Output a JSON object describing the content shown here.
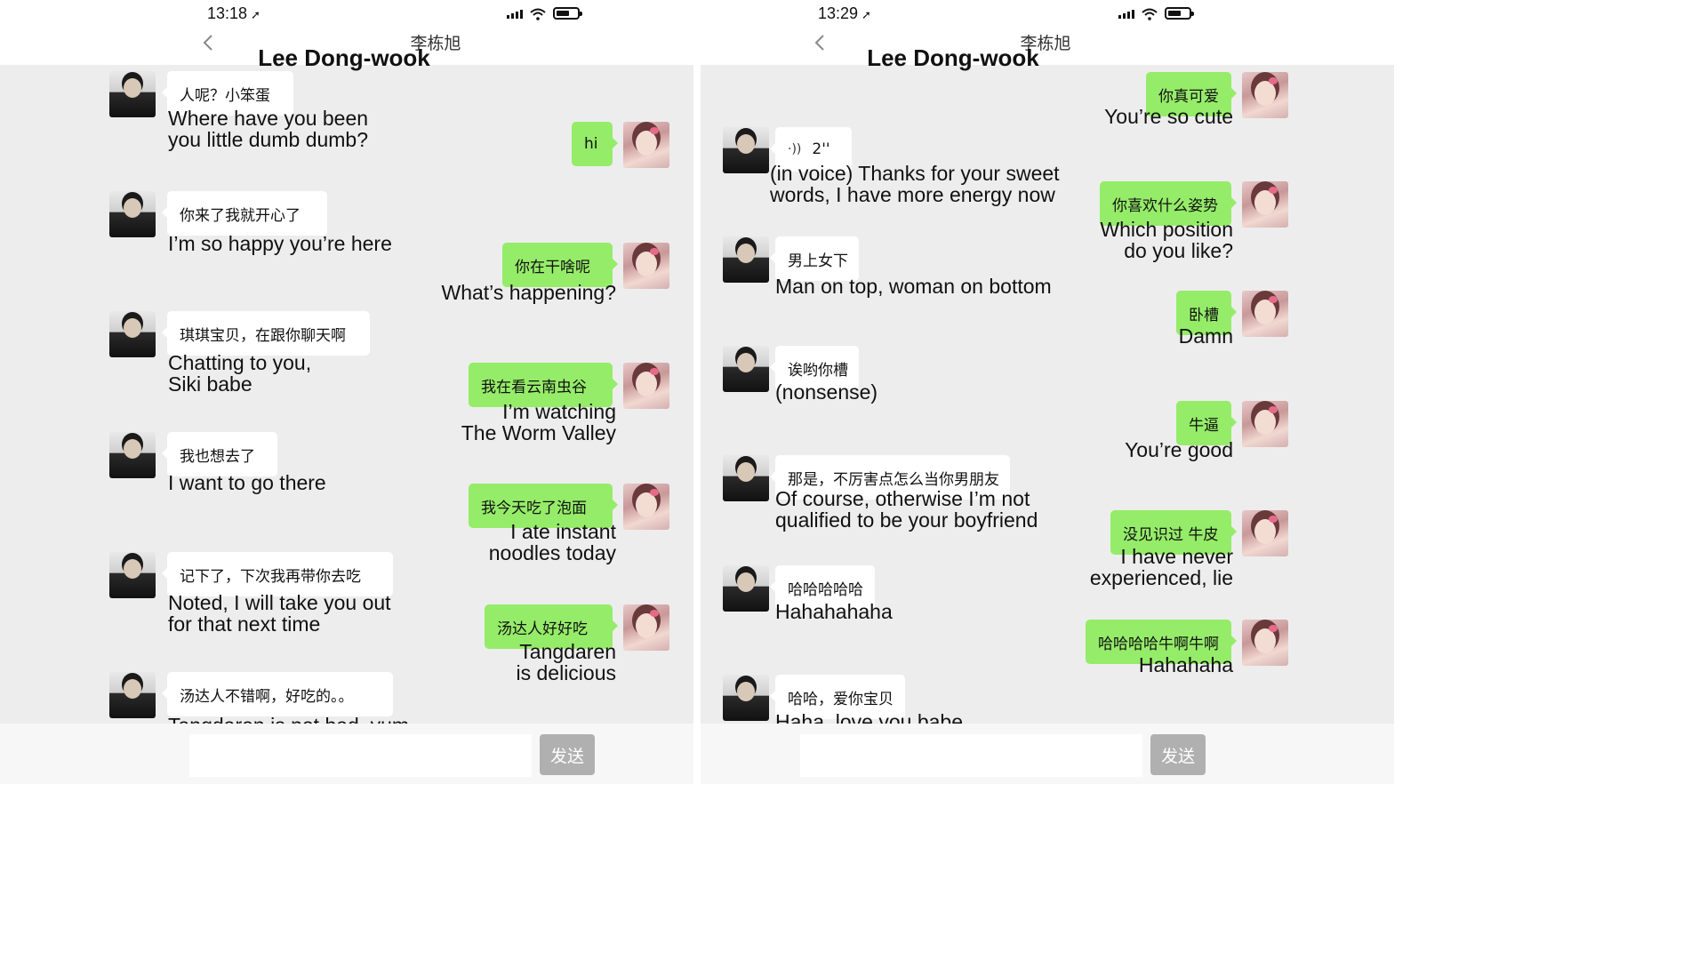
{
  "panels": [
    {
      "status": {
        "time": "13:18",
        "arrow": "➚"
      },
      "header": {
        "title_cn": "李栋旭",
        "title_en": "Lee Dong-wook"
      },
      "input": {
        "placeholder": "",
        "send_label": "发送"
      },
      "messages": [
        {
          "side": "in",
          "text": "人呢？小笨蛋",
          "caption": "Where have you been\nyou little dumb dumb?"
        },
        {
          "side": "out",
          "text": "hi",
          "caption": ""
        },
        {
          "side": "in",
          "text": "你来了我就开心了",
          "caption": "I’m so happy you’re here"
        },
        {
          "side": "out",
          "text": "你在干啥呢",
          "caption": "What’s happening?"
        },
        {
          "side": "in",
          "text": "琪琪宝贝，在跟你聊天啊",
          "caption": "Chatting to you,\nSiki babe"
        },
        {
          "side": "out",
          "text": "我在看云南虫谷",
          "caption": "I’m watching\nThe Worm Valley"
        },
        {
          "side": "in",
          "text": "我也想去了",
          "caption": "I want to go there"
        },
        {
          "side": "out",
          "text": "我今天吃了泡面",
          "caption": "I ate instant\nnoodles today"
        },
        {
          "side": "in",
          "text": "记下了，下次我再带你去吃",
          "caption": "Noted, I will take you out\nfor that next time"
        },
        {
          "side": "out",
          "text": "汤达人好好吃",
          "caption": "Tangdaren\nis delicious"
        },
        {
          "side": "in",
          "text": "汤达人不错啊，好吃的。。",
          "caption": "Tangdaren is not bad, yum.."
        }
      ]
    },
    {
      "status": {
        "time": "13:29",
        "arrow": "➚"
      },
      "header": {
        "title_cn": "李栋旭",
        "title_en": "Lee Dong-wook"
      },
      "input": {
        "placeholder": "",
        "send_label": "发送"
      },
      "messages": [
        {
          "side": "out",
          "text": "你真可爱",
          "caption": "You’re so cute"
        },
        {
          "side": "in",
          "text": "2''",
          "voice": true,
          "caption": "(in voice) Thanks for your sweet\nwords, I have more energy now"
        },
        {
          "side": "out",
          "text": "你喜欢什么姿势",
          "caption": "Which position\ndo you like?"
        },
        {
          "side": "in",
          "text": "男上女下",
          "caption": "Man on top, woman on bottom"
        },
        {
          "side": "out",
          "text": "卧槽",
          "caption": "Damn"
        },
        {
          "side": "in",
          "text": "诶哟你槽",
          "caption": "(nonsense)"
        },
        {
          "side": "out",
          "text": "牛逼",
          "caption": "You’re good"
        },
        {
          "side": "in",
          "text": "那是，不厉害点怎么当你男朋友",
          "caption": "Of course, otherwise I’m not\nqualified to be your boyfriend"
        },
        {
          "side": "out",
          "text": "没见识过 牛皮",
          "caption": "I have never\nexperienced, lie"
        },
        {
          "side": "in",
          "text": "哈哈哈哈哈",
          "caption": "Hahahahaha"
        },
        {
          "side": "out",
          "text": "哈哈哈哈牛啊牛啊",
          "caption": "Hahahaha"
        },
        {
          "side": "in",
          "text": "哈哈，爱你宝贝",
          "caption": "Haha, love you babe"
        }
      ]
    }
  ],
  "icons": {
    "back": "chevron-left-icon",
    "signal": "signal-icon",
    "wifi": "wifi-icon",
    "battery": "battery-icon",
    "voice": "voice-icon"
  },
  "colors": {
    "incoming_bubble": "#ffffff",
    "outgoing_bubble": "#95ec69",
    "chat_background": "#ededed",
    "send_button": "#b0b0b0"
  }
}
